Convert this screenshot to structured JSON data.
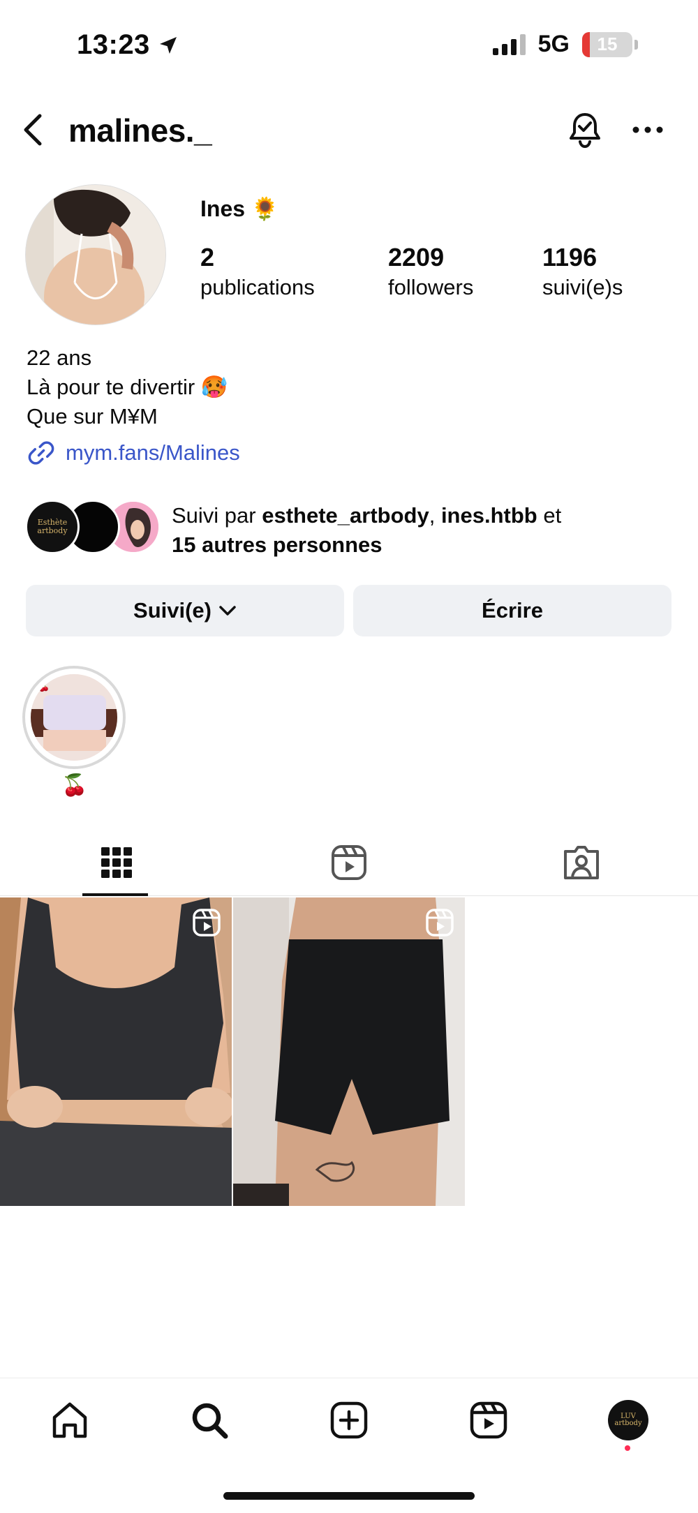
{
  "status_bar": {
    "time": "13:23",
    "network": "5G",
    "battery": "15",
    "battery_level_percent": 15
  },
  "header": {
    "username": "malines._"
  },
  "profile": {
    "display_name": "Ines 🌻",
    "stats": [
      {
        "value": "2",
        "label": "publications"
      },
      {
        "value": "2209",
        "label": "followers"
      },
      {
        "value": "1196",
        "label": "suivi(e)s"
      }
    ],
    "bio": [
      "22 ans",
      "Là pour te divertir 🥵",
      "Que sur M¥M"
    ],
    "link": "mym.fans/Malines"
  },
  "followed_by": {
    "prefix": "Suivi par ",
    "user1": "esthete_artbody",
    "sep": ", ",
    "user2": "ines.htbb",
    "and": " et",
    "others": "15 autres personnes",
    "fav1_text": "Esthète artbody"
  },
  "actions": {
    "following_label": "Suivi(e)",
    "message_label": "Écrire"
  },
  "highlights": [
    {
      "label": "🍒"
    }
  ],
  "tabs": [
    "grid-icon",
    "reels-icon",
    "tagged-icon"
  ],
  "bottom_nav": {
    "items": [
      "home-icon",
      "search-icon",
      "create-icon",
      "reels-icon",
      "profile-avatar"
    ],
    "avatar_text": "LUV artbody"
  },
  "colors": {
    "link": "#3a56c9",
    "button_bg": "#eff1f4",
    "battery_red": "#e53935",
    "notification_dot": "#ff2d55"
  }
}
